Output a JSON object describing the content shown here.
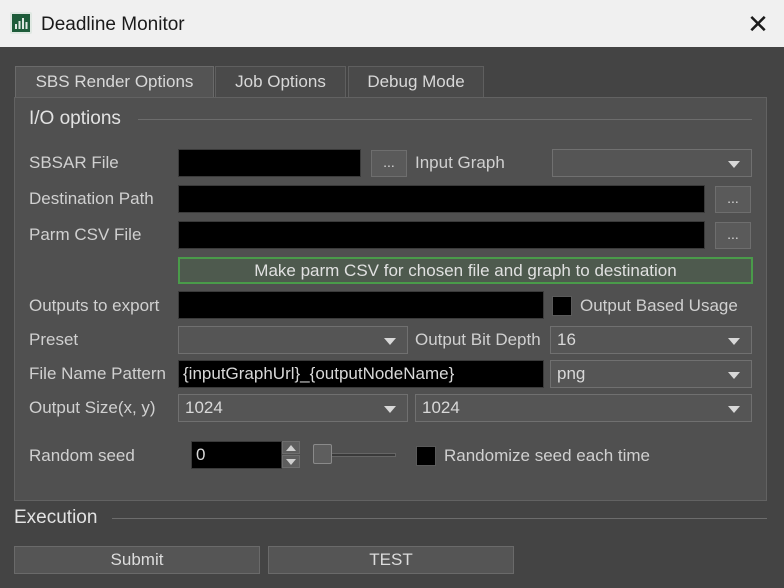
{
  "window": {
    "title": "Deadline Monitor",
    "close_glyph": "✕",
    "app_icon": "monitor-icon"
  },
  "tabs": [
    {
      "label": "SBS Render Options",
      "active": true
    },
    {
      "label": "Job Options",
      "active": false
    },
    {
      "label": "Debug Mode",
      "active": false
    }
  ],
  "io": {
    "group_title": "I/O options",
    "sbsar_label": "SBSAR File",
    "sbsar_value": "",
    "browse": "...",
    "input_graph_label": "Input Graph",
    "input_graph_value": "",
    "dest_label": "Destination Path",
    "dest_value": "",
    "parm_label": "Parm CSV File",
    "parm_value": "",
    "make_csv_button": "Make parm CSV for chosen file and graph to destination",
    "outputs_label": "Outputs to export",
    "outputs_value": "",
    "output_usage_label": "Output Based Usage",
    "preset_label": "Preset",
    "preset_value": "",
    "bit_depth_label": "Output Bit Depth",
    "bit_depth_value": "16",
    "pattern_label": "File Name Pattern",
    "pattern_value": "{inputGraphUrl}_{outputNodeName}",
    "format_value": "png",
    "size_label": "Output Size(x, y)",
    "size_x": "1024",
    "size_y": "1024",
    "seed_label": "Random seed",
    "seed_value": "0",
    "randomize_label": "Randomize seed each time"
  },
  "execution": {
    "title": "Execution",
    "submit": "Submit",
    "test": "TEST"
  },
  "colors": {
    "accent_green": "#4a9b4a",
    "panel_bg": "#505050",
    "window_bg": "#444444"
  }
}
